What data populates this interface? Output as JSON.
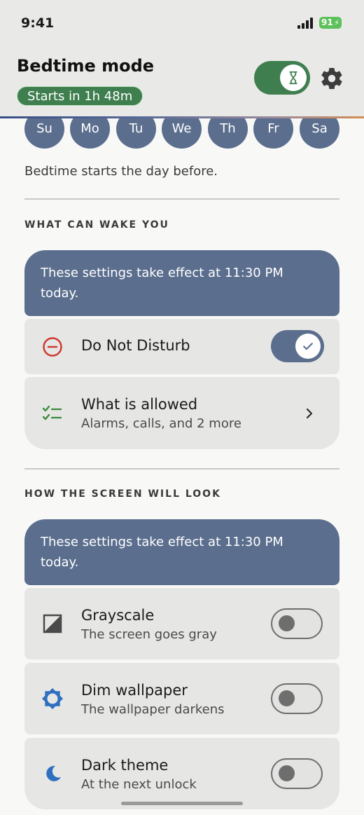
{
  "status_bar": {
    "time": "9:41",
    "battery": "91"
  },
  "header": {
    "title": "Bedtime mode",
    "starts_pill": "Starts in 1h 48m",
    "toggle_on": true,
    "icons": {
      "toggle": "hourglass-icon",
      "settings": "gear-icon"
    }
  },
  "days": [
    "Su",
    "Mo",
    "Tu",
    "We",
    "Th",
    "Fr",
    "Sa"
  ],
  "schedule_note": "Bedtime starts the day before.",
  "wake_section": {
    "label": "WHAT CAN WAKE YOU",
    "banner": "These settings take effect at 11:30 PM today.",
    "dnd": {
      "title": "Do Not Disturb",
      "enabled": true,
      "icon": "do-not-disturb-icon"
    },
    "allowed": {
      "title": "What is allowed",
      "subtitle": "Alarms, calls, and 2 more",
      "icon": "checklist-icon"
    }
  },
  "screen_section": {
    "label": "HOW THE SCREEN WILL LOOK",
    "banner": "These settings take effect at 11:30 PM today.",
    "items": [
      {
        "title": "Grayscale",
        "subtitle": "The screen goes gray",
        "enabled": false,
        "icon": "grayscale-icon"
      },
      {
        "title": "Dim wallpaper",
        "subtitle": "The wallpaper darkens",
        "enabled": false,
        "icon": "brightness-icon"
      },
      {
        "title": "Dark theme",
        "subtitle": "At the next unlock",
        "enabled": false,
        "icon": "moon-icon"
      }
    ]
  },
  "colors": {
    "accent_green": "#3f7f4f",
    "slate_blue": "#5b6e8e",
    "dnd_red": "#d03a32",
    "check_green": "#3a8a3a",
    "icon_blue": "#2f6fc0"
  }
}
